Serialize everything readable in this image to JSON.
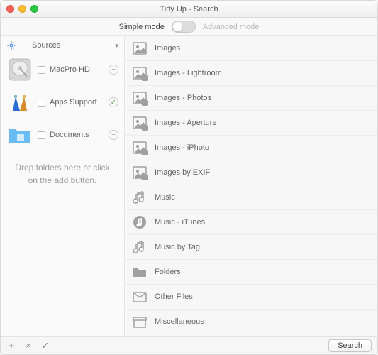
{
  "window": {
    "title": "Tidy Up - Search"
  },
  "modebar": {
    "simple": "Simple mode",
    "advanced": "Advanced mode"
  },
  "sidebar": {
    "gear_icon": "gear",
    "sources_label": "Sources",
    "items": [
      {
        "icon": "hdd",
        "label": "MacPro HD",
        "checked": false,
        "expander": "minus"
      },
      {
        "icon": "apptools",
        "label": "Apps Support",
        "checked": false,
        "expander": "check"
      },
      {
        "icon": "folder",
        "label": "Documents",
        "checked": false,
        "expander": "minus"
      }
    ],
    "drop_message": "Drop folders here or click on the add button."
  },
  "categories": [
    {
      "icon": "image",
      "label": "Images"
    },
    {
      "icon": "image-lr",
      "label": "Images - Lightroom"
    },
    {
      "icon": "image-photos",
      "label": "Images - Photos"
    },
    {
      "icon": "image-aperture",
      "label": "Images - Aperture"
    },
    {
      "icon": "image-iphoto",
      "label": "Images - iPhoto"
    },
    {
      "icon": "image-exif",
      "label": "Images by EXIF"
    },
    {
      "icon": "music",
      "label": "Music"
    },
    {
      "icon": "music-itunes",
      "label": "Music - iTunes"
    },
    {
      "icon": "music-tag",
      "label": "Music by Tag"
    },
    {
      "icon": "folders",
      "label": "Folders"
    },
    {
      "icon": "other",
      "label": "Other Files"
    },
    {
      "icon": "misc",
      "label": "Miscellaneous"
    }
  ],
  "footer": {
    "add": "+",
    "remove": "×",
    "confirm": "✓",
    "search": "Search"
  }
}
